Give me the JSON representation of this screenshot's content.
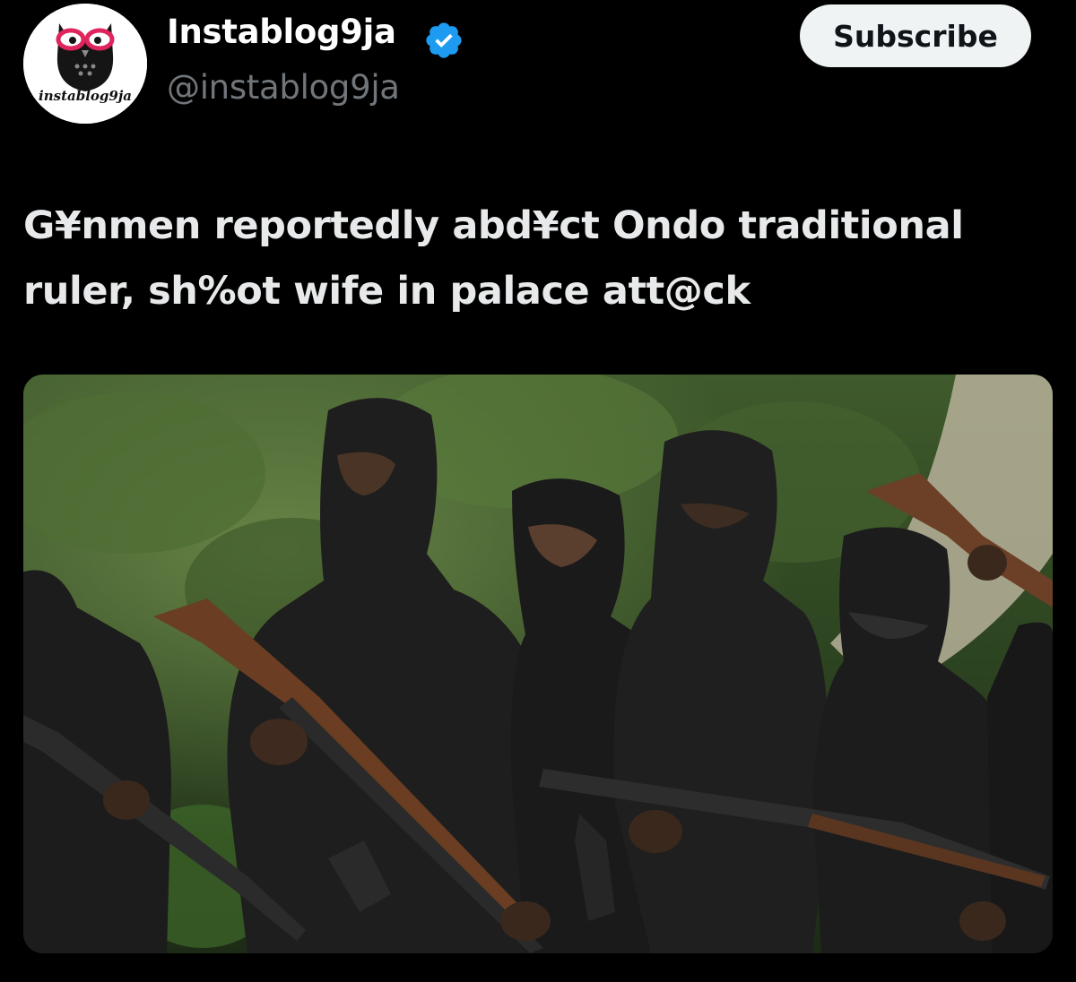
{
  "account": {
    "display_name": "Instablog9ja",
    "handle": "@instablog9ja",
    "avatar_text": "instablog9ja",
    "verified_icon": "verified-badge-icon",
    "verified_color": "#1d9bf0"
  },
  "actions": {
    "subscribe_label": "Subscribe"
  },
  "post": {
    "headline": "G¥nmen reportedly abd¥ct Ondo traditional ruler, sh%ot wife in palace att@ck",
    "media_icon": "photo"
  },
  "theme": {
    "background": "#000000",
    "text": "#e7e9ea",
    "secondary_text": "#71767b",
    "button_bg": "#eff3f4"
  }
}
